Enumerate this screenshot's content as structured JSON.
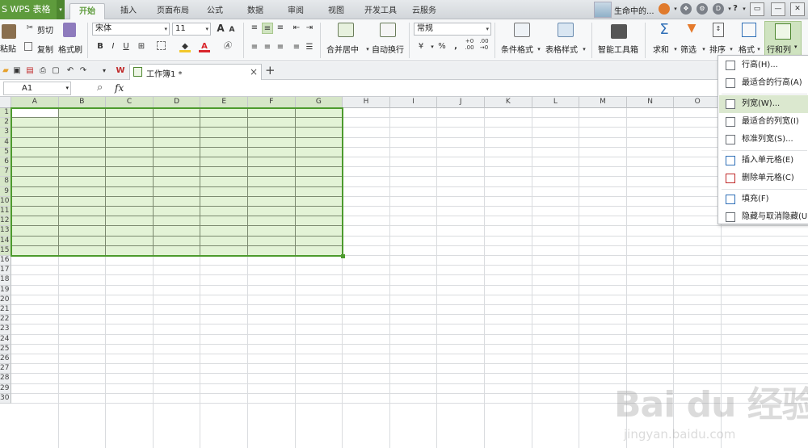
{
  "app": {
    "logo": "S WPS 表格",
    "caret": "▾"
  },
  "tabs": [
    {
      "label": "开始",
      "active": true
    },
    {
      "label": "插入"
    },
    {
      "label": "页面布局"
    },
    {
      "label": "公式"
    },
    {
      "label": "数据"
    },
    {
      "label": "审阅"
    },
    {
      "label": "视图"
    },
    {
      "label": "开发工具"
    },
    {
      "label": "云服务"
    }
  ],
  "user": {
    "name": "生命中的...",
    "caret": "▾"
  },
  "title_icons": {
    "a": "❖",
    "b": "⚙",
    "c": "D",
    "help": "?",
    "caret1": "▾",
    "caret2": "▾",
    "min": "—",
    "max": "▭",
    "close": "✕"
  },
  "ribbon": {
    "paste": "粘贴",
    "cut": "剪切",
    "copy": "复制",
    "format_painter": "格式刷",
    "font_name": "宋体",
    "font_size": "11",
    "grow": "A",
    "shrink": "A",
    "bold": "B",
    "italic": "I",
    "underline": "U",
    "merge_center": "合并居中",
    "wrap_text": "自动换行",
    "number_format": "常规",
    "percent": "%",
    "thousands": ",",
    "inc_decimal": "+0\n.00",
    "dec_decimal": ".00\n→0",
    "cond_format": "条件格式",
    "table_style": "表格样式",
    "smart_tools": "智能工具箱",
    "sum": "求和",
    "filter": "筛选",
    "sort": "排序",
    "format": "格式",
    "row_col": "行和列",
    "caret": "▾",
    "glyph_sum": "Σ",
    "glyph_font_color": "A",
    "glyph_borders": "⊞"
  },
  "qa": {
    "doc_tab": "工作簿1 *",
    "close": "×",
    "add": "+",
    "wps_logo": "W",
    "more": "▾"
  },
  "formula": {
    "cell_ref": "A1",
    "fx": "fx",
    "zoom_icon": "⌕"
  },
  "columns": [
    "A",
    "B",
    "C",
    "D",
    "E",
    "F",
    "G",
    "H",
    "I",
    "J",
    "K",
    "L",
    "M",
    "N",
    "O"
  ],
  "rows": [
    "1",
    "2",
    "3",
    "4",
    "5",
    "6",
    "7",
    "8",
    "9",
    "10",
    "11",
    "12",
    "13",
    "14",
    "15",
    "16",
    "17",
    "18",
    "19",
    "20",
    "21",
    "22",
    "23",
    "24",
    "25",
    "26",
    "27",
    "28",
    "29",
    "30"
  ],
  "menu": {
    "row_height": "行高(H)...",
    "best_row_height": "最适合的行高(A)",
    "col_width": "列宽(W)...",
    "best_col_width": "最适合的列宽(I)",
    "std_col_width": "标准列宽(S)...",
    "insert_cells": "插入单元格(E)",
    "delete_cells": "删除单元格(C)",
    "fill": "填充(F)",
    "hide_unhide": "隐藏与取消隐藏(U)"
  },
  "watermark": {
    "brand": "Bai du 经验",
    "url": "jingyan.baidu.com"
  },
  "colors": {
    "brand_green": "#5e9b3c",
    "selection_fill": "#e3f3d6",
    "selection_border": "#4d9b2e",
    "menu_hover": "#dbe8cf"
  }
}
